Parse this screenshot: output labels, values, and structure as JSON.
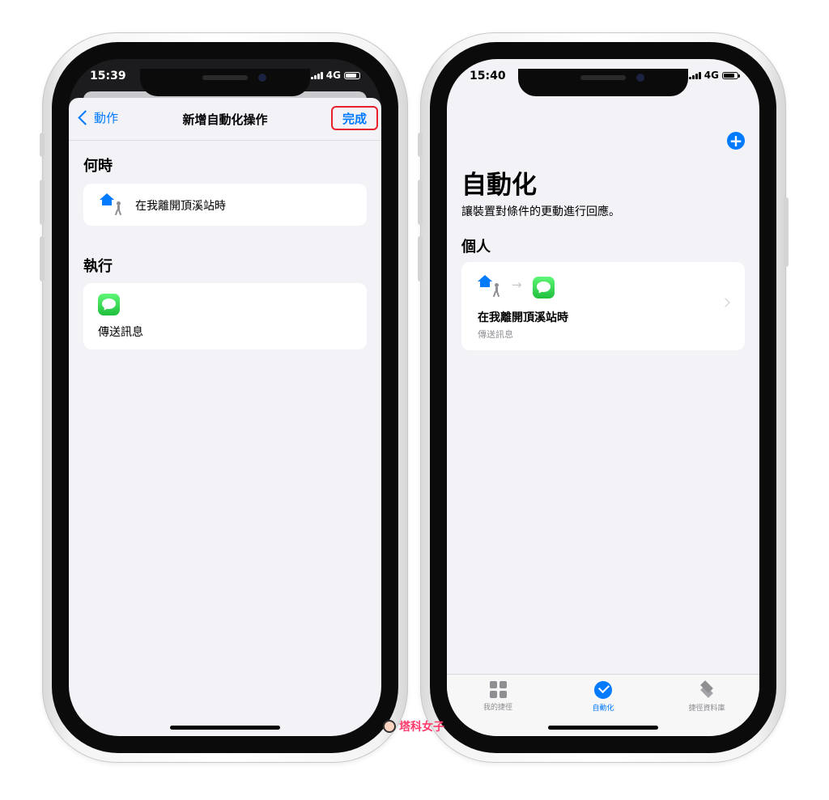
{
  "left_phone": {
    "status": {
      "time": "15:39",
      "network": "4G"
    },
    "nav": {
      "back_label": "動作",
      "title": "新增自動化操作",
      "done_label": "完成"
    },
    "when": {
      "header": "何時",
      "trigger_text": "在我離開頂溪站時"
    },
    "do": {
      "header": "執行",
      "action_text": "傳送訊息"
    }
  },
  "right_phone": {
    "status": {
      "time": "15:40",
      "network": "4G"
    },
    "title": "自動化",
    "subtitle": "讓裝置對條件的更動進行回應。",
    "section_header": "個人",
    "automation": {
      "title": "在我離開頂溪站時",
      "subtitle": "傳送訊息"
    },
    "tabs": [
      {
        "label": "我的捷徑",
        "icon": "grid-icon"
      },
      {
        "label": "自動化",
        "icon": "checkmark-circle-icon"
      },
      {
        "label": "捷徑資料庫",
        "icon": "layers-icon"
      }
    ]
  },
  "watermark": {
    "text": "塔科女子"
  },
  "colors": {
    "accent": "#007aff",
    "highlight": "#e8202e",
    "background": "#f2f2f7"
  }
}
